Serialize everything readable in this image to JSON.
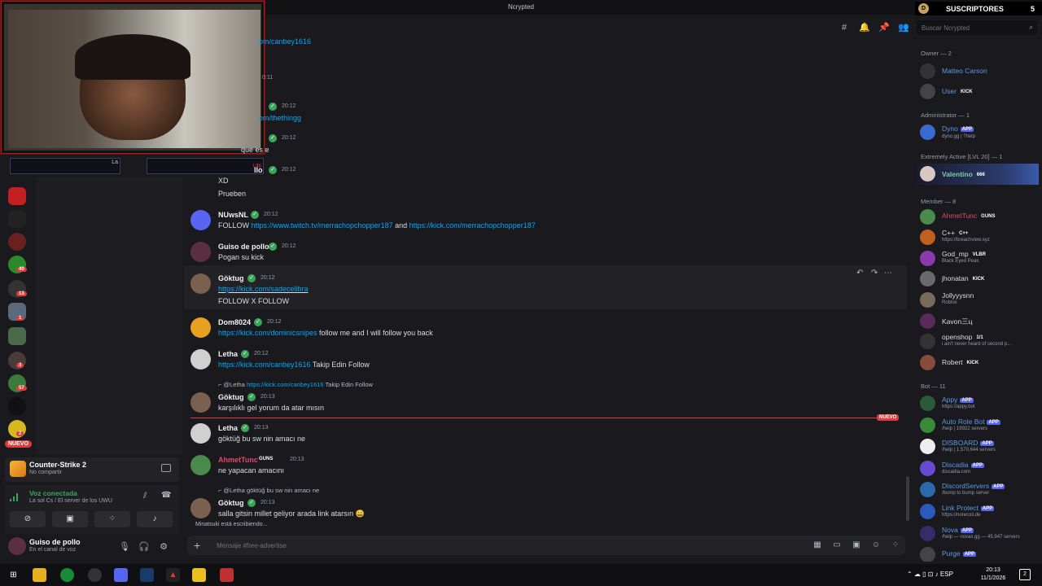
{
  "window": {
    "title": "Ncrypted",
    "subs_label": "SUSCRIPTORES",
    "subs_count": "5",
    "subs_avatar": "D"
  },
  "header": {
    "search_placeholder": "Buscar Ncrypted"
  },
  "server_badges": {
    "b1": "40",
    "b2": "13",
    "b3": "1",
    "b4": "3",
    "b5": "57",
    "b6": "2",
    "nuevo": "NUEVO"
  },
  "activity": {
    "game": "Counter-Strike 2",
    "status": "No compartir"
  },
  "voice": {
    "status": "Voz conectada",
    "channel": "La sol Cs / El server de los UWU"
  },
  "user": {
    "name": "Guiso de pollo",
    "status": "En el canal de voz"
  },
  "overlay": {
    "cam_left_text": "La",
    "cam_right_text": "Ulti"
  },
  "messages": {
    "partial1_link": "om/canbey1616",
    "partial1_ts": "0:11",
    "partial2_ts": "20:12",
    "partial2_link": "om/thethingg",
    "partial3_ts": "20:12",
    "partial3_text": "que es e",
    "partial4_name": "llo",
    "partial4_ts": "20:12",
    "partial4_text1": "XD",
    "partial4_text2": "Prueben",
    "m1_name": "NUwsNL",
    "m1_ts": "20:12",
    "m1_pre": "FOLLOW ",
    "m1_link1": "https://www.twitch.tv/merrachopchopper187",
    "m1_mid": " and ",
    "m1_link2": "https://kick.com/merrachopchopper187",
    "m2_name": "Guiso de pollo",
    "m2_ts": "20:12",
    "m2_text": "Pogan su kick",
    "m3_name": "Göktug",
    "m3_ts": "20:12",
    "m3_link": "https://kick.com/sadecelibra",
    "m3_text": "FOLLOW X FOLLOW",
    "m4_name": "Dom8024",
    "m4_ts": "20:12",
    "m4_link": "https://kick.com/dominicsnipes",
    "m4_text": " follow me and I will follow you back",
    "m5_name": "Letha",
    "m5_ts": "20:12",
    "m5_link": "https://kick.com/canbey1616",
    "m5_text": " Takip Edin Follow",
    "r6_author": "@Letha",
    "r6_link": "https://kick.com/canbey1616",
    "r6_text": " Takip Edin Follow",
    "m6_name": "Göktug",
    "m6_ts": "20:13",
    "m6_text": "karşılıklı gel yorum da atar mısın",
    "new_tag": "NUEVO",
    "m7_name": "Letha",
    "m7_ts": "20:13",
    "m7_text": "göktüğ bu sw nin amacı ne",
    "m8_name": "AhmetTunc",
    "m8_tag": "GUNS",
    "m8_ts": "20:13",
    "m8_text": "ne yapacan amacını",
    "r9_author": "@Letha",
    "r9_text": " göktüğ bu sw nin amacı ne",
    "m9_name": "Göktug",
    "m9_ts": "20:13",
    "m9_text": "salla gitsin millet geliyor arada link atarsın 😄",
    "typing": "Minatsuki está escribiendo..."
  },
  "composer": {
    "placeholder": "Mensaje #free-advertise"
  },
  "members": {
    "owner_header": "Owner — 2",
    "o1": "Matteo Carson",
    "o2": "User",
    "o2_tag": "KICK",
    "admin_header": "Administrator — 1",
    "a1": "Dyno",
    "a1_sub": "dyno.gg | ?help",
    "active_header": "Extremely Active [LVL 20] — 1",
    "v1": "Valentino",
    "v1_tag": "666",
    "member_header": "Member — 8",
    "mb1": "AhmetTunc",
    "mb1_tag": "GUNS",
    "mb2": "C++",
    "mb2_tag": "C++",
    "mb2_sub": "https://breachview.xyz",
    "mb3": "God_mp",
    "mb3_tag": "VLBR",
    "mb3_sub": "Black Eyed Peas",
    "mb4": "jhonatan",
    "mb4_tag": "KICK",
    "mb5": "Jollyyysnn",
    "mb5_sub": "Roblox",
    "mb6": "Kavon三ц",
    "mb7": "openshop",
    "mb7_tag": "1/1",
    "mb7_sub": "i ain't never heard of second p...",
    "mb8": "Robert",
    "mb8_tag": "KICK",
    "bot_header": "Bot — 11",
    "b1": "Appy",
    "b1_sub": "https://appy.bot",
    "b2": "Auto Role Bot",
    "b2_sub": "/help | 19922 servers",
    "b3": "DISBOARD",
    "b3_sub": "/help | 1,570,644 servers",
    "b4": "Discadia",
    "b4_sub": "discadia.com",
    "b5": "DiscordServers",
    "b5_sub": "/bump to bump server",
    "b6": "Link Protect",
    "b6_sub": "https://norecoil.de",
    "b7": "Nova",
    "b7_sub": "/help — novax.gg — 45,947 servers",
    "b8": "Purge",
    "app_tag": "APP"
  },
  "taskbar": {
    "time": "20:13",
    "date": "11/1/2026",
    "lang": "ESP",
    "notif": "2"
  },
  "colors": {
    "accent": "#5865f2",
    "link": "#00a8fc",
    "online": "#3ba55c",
    "danger": "#e03c3c",
    "guns": "#e04a6c"
  }
}
